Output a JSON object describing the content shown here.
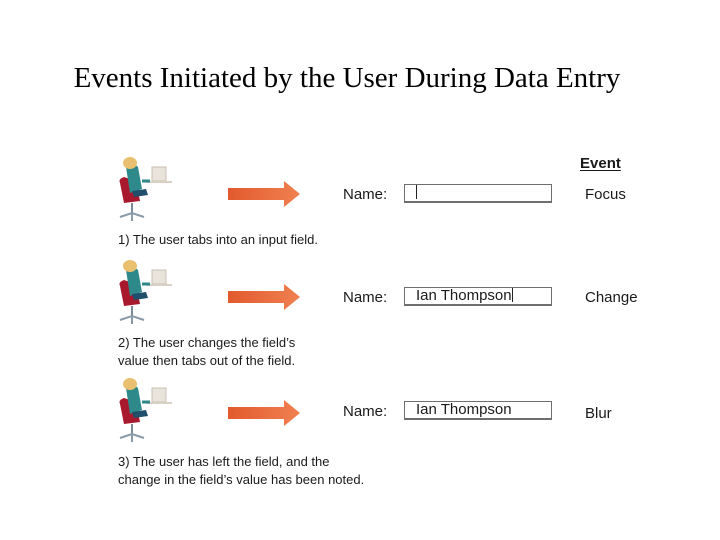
{
  "title": "Events Initiated by the User During Data Entry",
  "event_column_header": "Event",
  "colors": {
    "arrow": "#e8673a",
    "chair": "#a8192e",
    "shirt": "#2e8a8a",
    "hair": "#e8c070"
  },
  "steps": [
    {
      "field_label": "Name:",
      "field_value": "",
      "cursor_visible": true,
      "event": "Focus",
      "caption_lines": [
        "1) The user tabs into an input field."
      ]
    },
    {
      "field_label": "Name:",
      "field_value": "Ian Thompson",
      "cursor_visible": true,
      "event": "Change",
      "caption_lines": [
        "2) The user changes the field’s",
        "value then tabs out of the field."
      ]
    },
    {
      "field_label": "Name:",
      "field_value": "Ian Thompson",
      "cursor_visible": false,
      "event": "Blur",
      "caption_lines": [
        "3) The user has left the field, and the",
        "change in the field’s value has been noted."
      ]
    }
  ]
}
